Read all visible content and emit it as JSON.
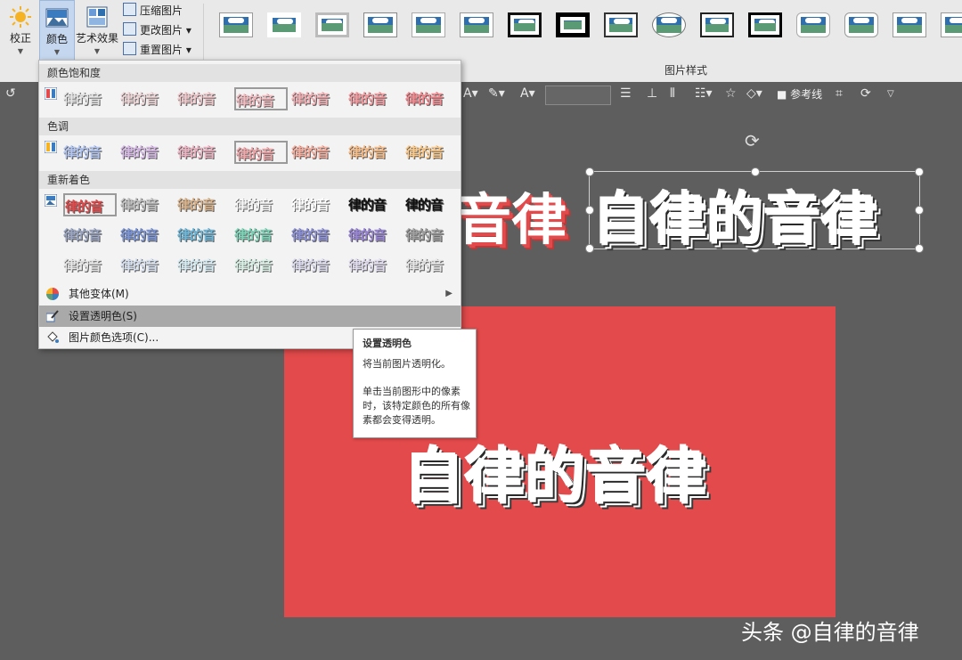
{
  "ribbon": {
    "correct_label": "校正",
    "color_label": "颜色",
    "art_effects_label": "艺术效果",
    "compress_label": "压缩图片",
    "change_label": "更改图片",
    "reset_label": "重置图片",
    "picture_styles_label": "图片样式",
    "style_count": 16
  },
  "canvas": {
    "sample_text": "自律的音律",
    "partial_text": "音律",
    "ref_line_label": "参考线",
    "watermark": "头条 @自律的音律",
    "slide_color": "#e24a4b"
  },
  "dropdown": {
    "saturation_header": "颜色饱和度",
    "tone_header": "色调",
    "recolor_header": "重新着色",
    "swatch_text": "律的音",
    "more_variants": "其他变体(M)",
    "set_transparent": "设置透明色(S)",
    "color_options": "图片颜色选项(C)...",
    "saturation_colors": [
      "#e6e6e6",
      "#efd6d8",
      "#f0c9cc",
      "#f2bcc0",
      "#f3b0b5",
      "#f59da2",
      "#f68b91"
    ],
    "tone_colors": [
      "#b3c6f2",
      "#d7b9e6",
      "#ecb4c3",
      "#f0a8ab",
      "#f7b0a0",
      "#f8be8a",
      "#fbc98a"
    ],
    "recolor_row1": [
      "#e24a4b",
      "#c2c2c2",
      "#d9b38c",
      "#f7f7f7",
      "#ffffff",
      "#111111",
      "#111111"
    ],
    "recolor_row2": [
      "#9aa6c2",
      "#7b95d6",
      "#6fb7d8",
      "#7ed4b8",
      "#8d92d6",
      "#9a86d6",
      "#a1a1a1"
    ],
    "recolor_row3": [
      "#e6e6e6",
      "#d6e0ee",
      "#d6ecf2",
      "#d9f0e6",
      "#dcdcee",
      "#e2dcef",
      "#e6e6e6"
    ]
  },
  "tooltip": {
    "title": "设置透明色",
    "line1": "将当前图片透明化。",
    "line2": "单击当前图形中的像素时，该特定颜色的所有像素都会变得透明。"
  }
}
